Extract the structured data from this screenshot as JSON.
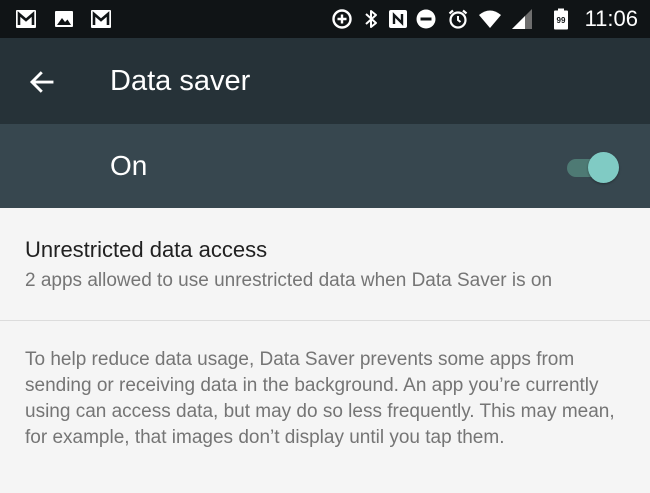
{
  "status_bar": {
    "time": "11:06",
    "battery_level": "99",
    "left_icons": [
      "gmail-icon",
      "image-icon",
      "gmail-icon"
    ],
    "right_icons": [
      "data-saver-icon",
      "bluetooth-icon",
      "nfc-icon",
      "do-not-disturb-icon",
      "alarm-icon",
      "wifi-icon",
      "cellular-signal-icon",
      "battery-icon"
    ]
  },
  "toolbar": {
    "title": "Data saver",
    "back_icon": "arrow-back-icon"
  },
  "master_switch": {
    "label": "On",
    "checked": true
  },
  "settings": [
    {
      "title": "Unrestricted data access",
      "summary": "2 apps allowed to use unrestricted data when Data Saver is on"
    }
  ],
  "footer": {
    "text": "To help reduce data usage, Data Saver prevents some apps from sending or receiving data in the background. An app you’re currently using can access data, but may do so less frequently. This may mean, for example, that images don’t display until you tap them."
  },
  "colors": {
    "status_bar": "#101416",
    "toolbar": "#263238",
    "switch_bar": "#37474f",
    "accent": "#80cbc4",
    "background": "#f5f5f5"
  }
}
